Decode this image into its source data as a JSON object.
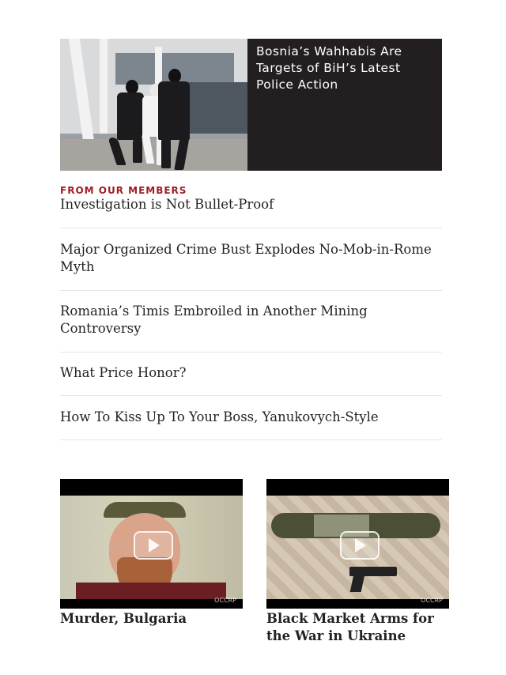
{
  "featured": {
    "title": "Bosnia’s Wahhabis Are Targets of BiH’s Latest Police Action",
    "image_icon": "police-arrest-photo"
  },
  "members": {
    "section_label": "FROM OUR MEMBERS",
    "items": [
      {
        "title": "Investigation is Not Bullet-Proof"
      },
      {
        "title": "Major Organized Crime Bust Explodes No-Mob-in-Rome Myth"
      },
      {
        "title": "Romania’s Timis Embroiled in Another Mining Controversy"
      },
      {
        "title": "What Price Honor?"
      },
      {
        "title": "How To Kiss Up To Your Boss, Yanukovych-Style"
      }
    ]
  },
  "videos": [
    {
      "title": "Murder, Bulgaria",
      "watermark": "OCCRP"
    },
    {
      "title": "Black Market Arms for the War in Ukraine",
      "watermark": "OCCRP"
    }
  ]
}
